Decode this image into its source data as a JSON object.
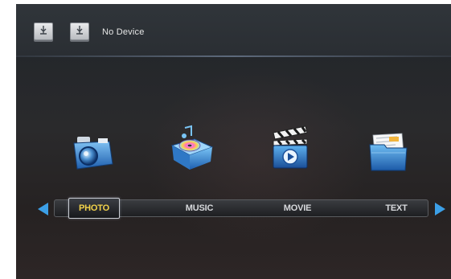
{
  "status": {
    "device_text": "No Device"
  },
  "icons": {
    "usb_slot_1": "usb-drive-icon",
    "usb_slot_2": "usb-drive-icon",
    "photo": "camera-icon",
    "music": "music-player-icon",
    "movie": "clapperboard-icon",
    "text": "folder-documents-icon",
    "nav_left": "left-arrow-icon",
    "nav_right": "right-arrow-icon"
  },
  "menu": {
    "selected": "PHOTO",
    "items": [
      {
        "label": "PHOTO"
      },
      {
        "label": "MUSIC"
      },
      {
        "label": "MOVIE"
      },
      {
        "label": "TEXT"
      }
    ]
  },
  "colors": {
    "selected_text": "#f2d24a",
    "arrow": "#3c9fe6",
    "item_text": "#d7d9dc"
  }
}
